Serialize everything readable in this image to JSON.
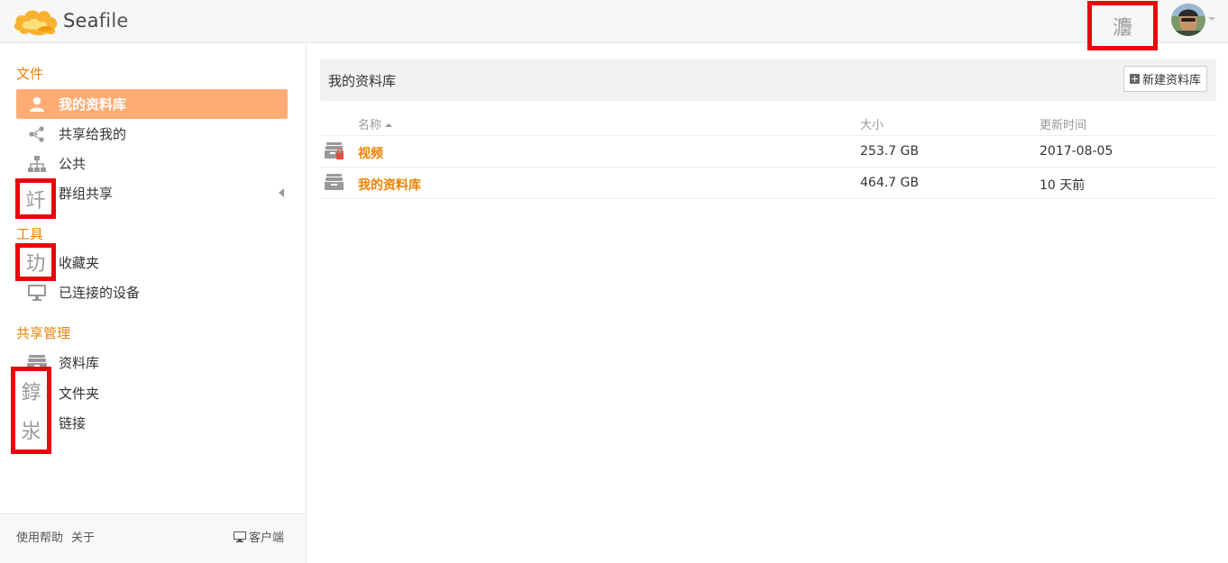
{
  "app": {
    "logo_text_sea": "Sea",
    "logo_text_file": "file"
  },
  "header": {
    "marked_glyph": "灋"
  },
  "sidebar": {
    "sections": [
      {
        "title": "文件"
      },
      {
        "title": "工具"
      },
      {
        "title": "共享管理"
      }
    ],
    "items": [
      {
        "label": "我的资料库",
        "icon": "user-icon"
      },
      {
        "label": "共享给我的",
        "icon": "share-icon"
      },
      {
        "label": "公共",
        "icon": "sitemap-icon"
      },
      {
        "label": "群组共享",
        "icon": "group-icon",
        "glyph": "竏"
      },
      {
        "label": "收藏夹",
        "icon": "star-icon",
        "glyph": "玏"
      },
      {
        "label": "已连接的设备",
        "icon": "monitor-icon"
      },
      {
        "label": "资料库",
        "icon": "library-icon"
      },
      {
        "label": "文件夹",
        "icon": "folder-icon",
        "glyph": "錞"
      },
      {
        "label": "链接",
        "icon": "link-icon",
        "glyph": "汖"
      }
    ],
    "footer": {
      "help": "使用帮助",
      "about": "关于",
      "client": "客户端"
    }
  },
  "main": {
    "title": "我的资料库",
    "new_button": "新建资料库",
    "columns": {
      "name": "名称",
      "size": "大小",
      "updated": "更新时间"
    },
    "rows": [
      {
        "name": "视频",
        "size": "253.7 GB",
        "updated": "2017-08-05",
        "icon": "encrypted-library-icon"
      },
      {
        "name": "我的资料库",
        "size": "464.7 GB",
        "updated": "10 天前",
        "icon": "library-icon"
      }
    ]
  },
  "colors": {
    "accent": "#eb8205",
    "active_bg": "#feac74",
    "marker": "#e8060d"
  }
}
